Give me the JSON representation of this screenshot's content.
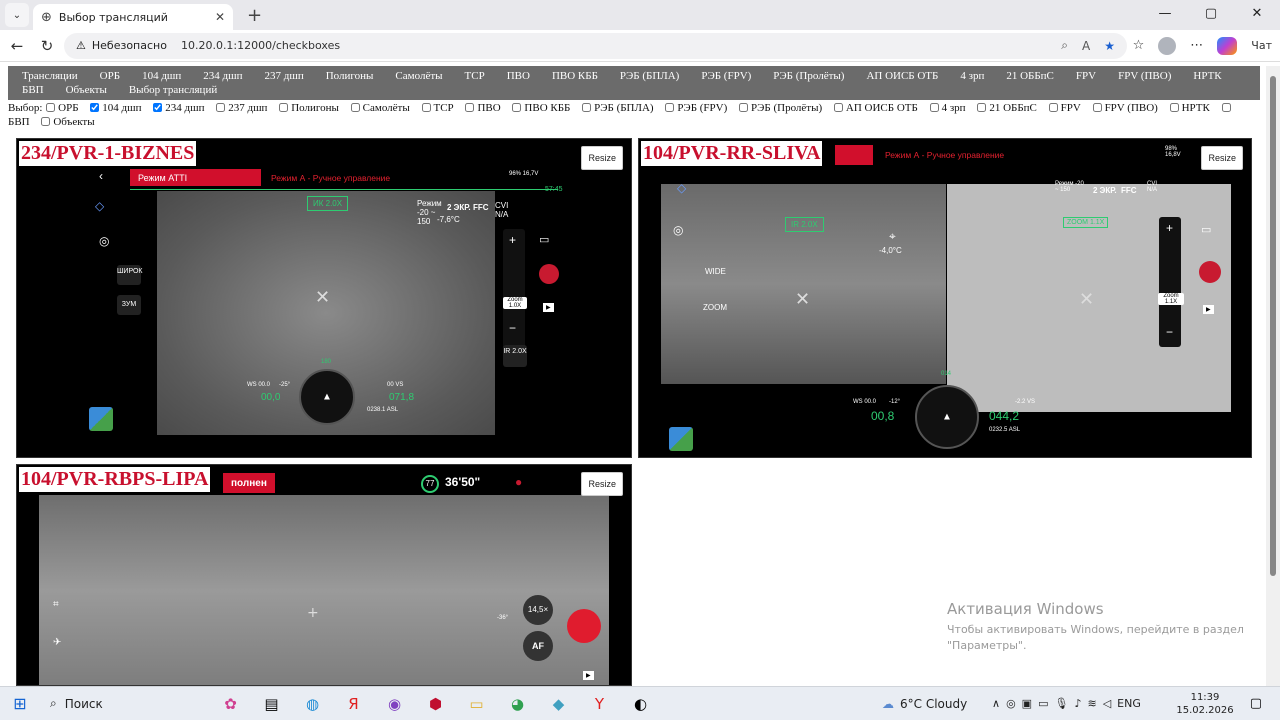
{
  "browser": {
    "tab_title": "Выбор трансляций",
    "security_label": "Небезопасно",
    "url": "10.20.0.1:12000/checkboxes",
    "copilot_label": "Чат"
  },
  "topnav": [
    "Трансляции",
    "ОРБ",
    "104 дшп",
    "234 дшп",
    "237 дшп",
    "Полигоны",
    "Самолёты",
    "ТСР",
    "ПВО",
    "ПВО КББ",
    "РЭБ (БПЛА)",
    "РЭБ (FPV)",
    "РЭБ (Пролёты)",
    "АП ОИСБ ОТБ",
    "4 зрп",
    "21 ОББпС",
    "FPV",
    "FPV (ПВО)",
    "НРТК",
    "БВП",
    "Объекты",
    "Выбор трансляций"
  ],
  "selection": {
    "label": "Выбор:",
    "options": [
      {
        "label": "ОРБ",
        "checked": false
      },
      {
        "label": "104 дшп",
        "checked": true
      },
      {
        "label": "234 дшп",
        "checked": true
      },
      {
        "label": "237 дшп",
        "checked": false
      },
      {
        "label": "Полигоны",
        "checked": false
      },
      {
        "label": "Самолёты",
        "checked": false
      },
      {
        "label": "ТСР",
        "checked": false
      },
      {
        "label": "ПВО",
        "checked": false
      },
      {
        "label": "ПВО КББ",
        "checked": false
      },
      {
        "label": "РЭБ (БПЛА)",
        "checked": false
      },
      {
        "label": "РЭБ (FPV)",
        "checked": false
      },
      {
        "label": "РЭБ (Пролёты)",
        "checked": false
      },
      {
        "label": "АП ОИСБ ОТБ",
        "checked": false
      },
      {
        "label": "4 зрп",
        "checked": false
      },
      {
        "label": "21 ОББпС",
        "checked": false
      },
      {
        "label": "FPV",
        "checked": false
      },
      {
        "label": "FPV (ПВО)",
        "checked": false
      },
      {
        "label": "НРТК",
        "checked": false
      },
      {
        "label": "БВП",
        "checked": false
      },
      {
        "label": "Объекты",
        "checked": false
      }
    ]
  },
  "feeds": [
    {
      "name": "234/PVR-1-BIZNES",
      "resize_label": "Resize",
      "mode_bar": "Режим ATTI",
      "mode_text": "Режим А - Ручное управление",
      "battery": "96% 16,7V",
      "time": "57:45",
      "ir_zoom": "ИК 2.0X",
      "range_label": "Режим -20 ~ 150",
      "temp": "-7,6°C",
      "shutter": "2 ЭКР.",
      "ffc": "FFC",
      "cvi": "CVI N/A",
      "side_btn_1": "ШИРОК",
      "side_btn_2": "ЗУМ",
      "zoom_label": "Zoom 1.0X",
      "ir_label": "IR 2.0X",
      "heading": "180",
      "ws": "WS 00.0",
      "speed": "00,0",
      "pitch": "-25°",
      "vs": "00 VS",
      "altitude": "071,8",
      "asl": "0238.1 ASL"
    },
    {
      "name": "104/PVR-RR-SLIVA",
      "resize_label": "Resize",
      "mode_text": "Режим А - Ручное управление",
      "battery": "98% 16,8V",
      "ir_zoom": "IR 2.0X",
      "zoom_label_2": "ZOOM 1.1X",
      "temp": "-4,0°C",
      "range_label": "Режим -20 ~ 150",
      "shutter": "2 ЭКР.",
      "ffc": "FFC",
      "cvi": "CVI N/A",
      "side_btn_1": "WIDE",
      "side_btn_2": "ZOOM",
      "zoom_label": "Zoom 1.1X",
      "heading": "014",
      "ws": "WS 00.0",
      "speed": "00,8",
      "pitch": "-12°",
      "vs": "-2.2 VS",
      "altitude": "044,2",
      "asl": "0232.5 ASL"
    },
    {
      "name": "104/PVR-RBPS-LIPA",
      "resize_label": "Resize",
      "mode_bar": "полнен",
      "signal": "77",
      "flight_time": "36'50\"",
      "zoom_value": "14,5×",
      "af_label": "AF",
      "gimbal": "-36°"
    }
  ],
  "watermark": {
    "title": "Активация Windows",
    "line1": "Чтобы активировать Windows, перейдите в раздел",
    "line2": "\"Параметры\"."
  },
  "taskbar": {
    "search_label": "Поиск",
    "weather": "6°C Cloudy",
    "lang": "ENG",
    "time": "11:39",
    "date": "15.02.2026"
  }
}
